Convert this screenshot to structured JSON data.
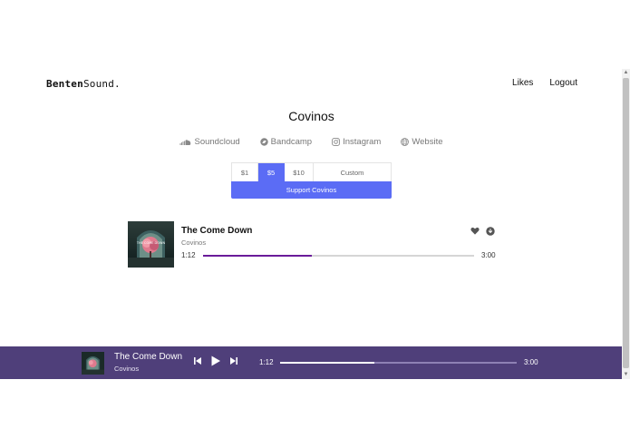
{
  "header": {
    "logo_bold": "Benten",
    "logo_rest": "Sound.",
    "nav": {
      "likes": "Likes",
      "logout": "Logout"
    }
  },
  "artist": {
    "name": "Covinos",
    "links": [
      {
        "label": "Soundcloud",
        "icon": "soundcloud-icon"
      },
      {
        "label": "Bandcamp",
        "icon": "bandcamp-icon"
      },
      {
        "label": "Instagram",
        "icon": "instagram-icon"
      },
      {
        "label": "Website",
        "icon": "globe-icon"
      }
    ]
  },
  "support": {
    "amounts": [
      "$1",
      "$5",
      "$10"
    ],
    "selected_amount": "$5",
    "custom_label": "Custom",
    "button_label": "Support Covinos",
    "accent_color": "#5b6cf5"
  },
  "track": {
    "title": "The Come Down",
    "artist": "Covinos",
    "current_time": "1:12",
    "total_time": "3:00",
    "progress": 0.4,
    "progress_color": "#6a1b9a",
    "actions": [
      "heart-icon",
      "download-icon"
    ]
  },
  "player": {
    "title": "The Come Down",
    "artist": "Covinos",
    "current_time": "1:12",
    "total_time": "3:00",
    "progress": 0.4,
    "background_color": "#4f3f7a",
    "controls": [
      "previous-icon",
      "play-icon",
      "next-icon"
    ]
  }
}
